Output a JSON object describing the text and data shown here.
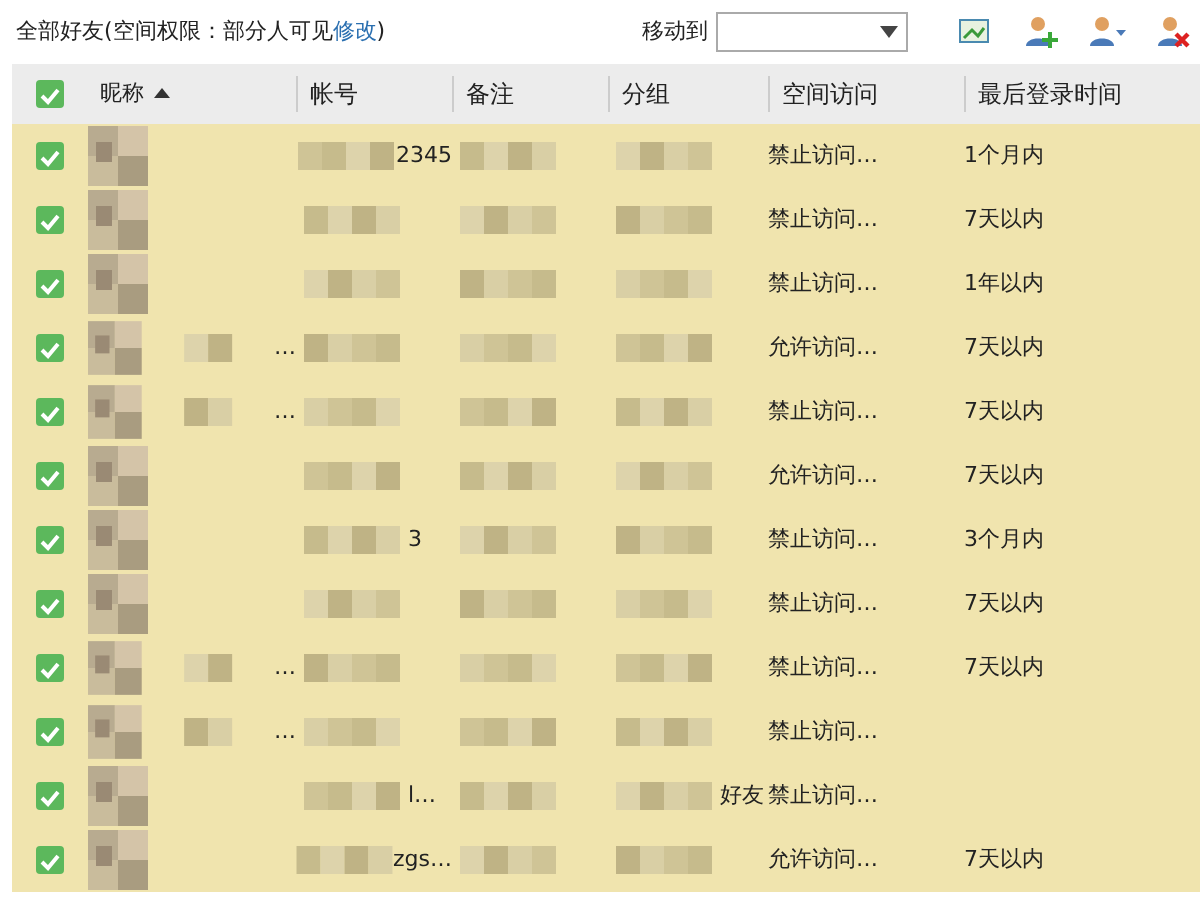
{
  "title": "全部好友(空间权限：部分人可见",
  "title_link": "修改",
  "title_end": ")",
  "move_label": "移动到",
  "columns": [
    {
      "label": "昵称",
      "sorted": true
    },
    {
      "label": "帐号",
      "sorted": false
    },
    {
      "label": "备注",
      "sorted": false
    },
    {
      "label": "分组",
      "sorted": false
    },
    {
      "label": "空间访问",
      "sorted": false
    },
    {
      "label": "最后登录时间",
      "sorted": false
    }
  ],
  "header_checked": true,
  "rows": [
    {
      "checked": true,
      "account": "2345",
      "access": "禁止访问…",
      "last_login": "1个月内"
    },
    {
      "checked": true,
      "access": "禁止访问…",
      "last_login": "7天以内"
    },
    {
      "checked": true,
      "access": "禁止访问…",
      "last_login": "1年以内"
    },
    {
      "checked": true,
      "nickname": "…",
      "access": "允许访问…",
      "last_login": "7天以内"
    },
    {
      "checked": true,
      "nickname": "…",
      "access": "禁止访问…",
      "last_login": "7天以内"
    },
    {
      "checked": true,
      "access": "允许访问…",
      "last_login": "7天以内"
    },
    {
      "checked": true,
      "account": "3",
      "access": "禁止访问…",
      "last_login": "3个月内"
    },
    {
      "checked": true,
      "access": "禁止访问…",
      "last_login": "7天以内"
    },
    {
      "checked": true,
      "nickname": "…",
      "access": "禁止访问…",
      "last_login": "7天以内"
    },
    {
      "checked": true,
      "nickname": "…",
      "access": "禁止访问…"
    },
    {
      "checked": true,
      "account": "l…",
      "group": "好友",
      "access": "禁止访问…"
    },
    {
      "checked": true,
      "account": "zgs…",
      "access": "允许访问…",
      "last_login": "7天以内"
    }
  ]
}
